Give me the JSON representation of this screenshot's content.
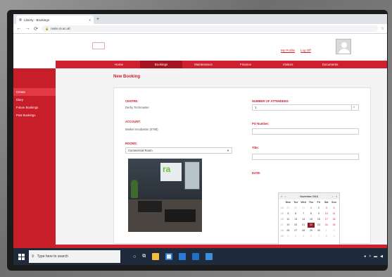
{
  "browser": {
    "tab_title": "Liberty - Bookings",
    "tab_close": "×",
    "new_tab": "+",
    "back": "←",
    "forward": "→",
    "reload": "⟳",
    "url_host": "name.ra.ac.uk/",
    "url_path": ""
  },
  "site": {
    "logo_text": "",
    "header_links": [
      "My Profile",
      "Log Off"
    ],
    "menu": [
      {
        "label": "Home",
        "active": false
      },
      {
        "label": "Bookings",
        "active": true
      },
      {
        "label": "Maintenance",
        "active": false
      },
      {
        "label": "Finance",
        "active": false
      },
      {
        "label": "Visitors",
        "active": false
      },
      {
        "label": "Documents",
        "active": false
      }
    ],
    "sidebar": [
      {
        "label": "Create",
        "active": true
      },
      {
        "label": "Diary",
        "active": false
      },
      {
        "label": "Future Bookings",
        "active": false
      },
      {
        "label": "Past Bookings",
        "active": false
      }
    ],
    "accent_color": "#d01f2e"
  },
  "booking": {
    "page_title": "New Booking",
    "centre_label": "CENTRE:",
    "centre_value": "Derby Techmaster",
    "account_label": "ACCOUNT:",
    "account_value": "Market Incubation (0798)",
    "rooms_label": "ROOMS:",
    "room_selected": "Commercial Room",
    "attendees_label": "NUMBER OF ATTENDEES:",
    "attendees_value": "1",
    "po_label": "PO Number:",
    "po_value": "",
    "title_label": "Title:",
    "title_value": "",
    "date_label": "DATE:",
    "photo_logo": "ra"
  },
  "calendar": {
    "month_label": "November 2018",
    "days_of_week": [
      "Mon",
      "Tue",
      "Wed",
      "Thu",
      "Fri",
      "Sat",
      "Sun"
    ],
    "weeks": [
      {
        "wk": "44",
        "days": [
          "29",
          "30",
          "31",
          "1",
          "2",
          "3",
          "4"
        ]
      },
      {
        "wk": "45",
        "days": [
          "5",
          "6",
          "7",
          "8",
          "9",
          "10",
          "11"
        ]
      },
      {
        "wk": "46",
        "days": [
          "12",
          "13",
          "14",
          "15",
          "16",
          "17",
          "18"
        ]
      },
      {
        "wk": "47",
        "days": [
          "19",
          "20",
          "21",
          "22",
          "23",
          "24",
          "25"
        ]
      },
      {
        "wk": "48",
        "days": [
          "26",
          "27",
          "28",
          "29",
          "30",
          "1",
          "2"
        ]
      },
      {
        "wk": "49",
        "days": [
          "3",
          "4",
          "5",
          "6",
          "7",
          "8",
          "9"
        ]
      }
    ],
    "selected_day": "22",
    "today_button": "Today"
  },
  "footer": {
    "copyright": "",
    "link": ""
  },
  "taskbar": {
    "search_placeholder": "Type here to search"
  }
}
